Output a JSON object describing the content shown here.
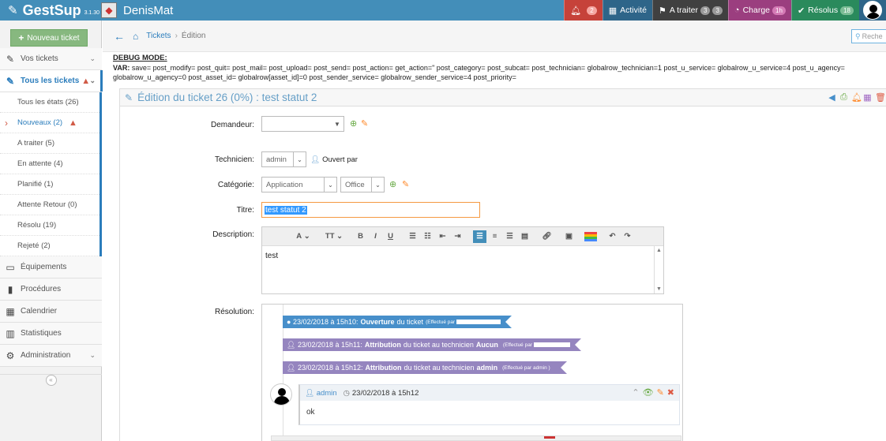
{
  "app": {
    "name": "GestSup",
    "version": "3.1.30",
    "username": "DenisMat"
  },
  "navbar": {
    "alerts_count": "2",
    "activity_label": "Activité",
    "todo_label": "A traiter",
    "todo_badge_1": "3",
    "todo_badge_2": "3",
    "charge_label": "Charge",
    "charge_badge": "1h",
    "resolved_label": "Résolus",
    "resolved_badge": "18"
  },
  "sidebar": {
    "new_ticket_label": "Nouveau ticket",
    "items": [
      {
        "label": "Vos tickets",
        "icon": "ticket-icon"
      },
      {
        "label": "Tous les tickets",
        "icon": "ticket-icon"
      }
    ],
    "subitems": [
      {
        "label": "Tous les états (26)"
      },
      {
        "label": "Nouveaux (2)"
      },
      {
        "label": "A traiter (5)"
      },
      {
        "label": "En attente (4)"
      },
      {
        "label": "Planifié (1)"
      },
      {
        "label": "Attente Retour (0)"
      },
      {
        "label": "Résolu (19)"
      },
      {
        "label": "Rejeté (2)"
      }
    ],
    "bottom_items": [
      {
        "label": "Équipements"
      },
      {
        "label": "Procédures"
      },
      {
        "label": "Calendrier"
      },
      {
        "label": "Statistiques"
      },
      {
        "label": "Administration"
      }
    ]
  },
  "breadcrumb": {
    "tickets": "Tickets",
    "separator": "›",
    "current": "Édition",
    "search_placeholder": "Reche"
  },
  "debug": {
    "title": "DEBUG MODE:",
    "var_label": "VAR:",
    "var_text": " save= post_modify= post_quit= post_mail= post_upload= post_send= post_action= get_action=\" post_category= post_subcat= post_technician= globalrow_technician=1 post_u_service= globalrow_u_service=4 post_u_agency= globalrow_u_agency=0 post_asset_id= globalrow[asset_id]=0 post_sender_service= globalrow_sender_service=4 post_priority="
  },
  "ticket": {
    "header": "Édition du ticket 26 (0%) : test statut 2",
    "requester_label": "Demandeur:",
    "requester_value": "",
    "technician_label": "Technicien:",
    "technician_value": "admin",
    "opened_by": "Ouvert par",
    "category_label": "Catégorie:",
    "category_value": "Application",
    "subcategory_value": "Office",
    "title_label": "Titre:",
    "title_value": "test statut 2",
    "description_label": "Description:",
    "description_value": "test",
    "resolution_label": "Résolution:"
  },
  "editor_toolbar": {
    "font": "A",
    "size": "TT",
    "bold": "B",
    "italic": "I",
    "underline": "U"
  },
  "timeline": {
    "events": [
      {
        "date": "23/02/2018 à 15h10:",
        "action": "Ouverture",
        "text": "du ticket",
        "by": "(Effectué par"
      },
      {
        "date": "23/02/2018 à 15h11:",
        "action": "Attribution",
        "text": "du ticket au technicien",
        "tech": "Aucun",
        "by": "(Effectué par"
      },
      {
        "date": "23/02/2018 à 15h12:",
        "action": "Attribution",
        "text": "du ticket au technicien",
        "tech": "admin",
        "by": "(Effectué par admin )"
      }
    ],
    "comment": {
      "author": "admin",
      "date": "23/02/2018 à 15h12",
      "text": "ok"
    }
  },
  "colors": {
    "primary": "#438eb9",
    "alert": "#c6423a",
    "charge": "#9b3e7f",
    "resolved": "#2a8a5c",
    "event_blue": "#478fca",
    "event_purple": "#9585bf"
  }
}
